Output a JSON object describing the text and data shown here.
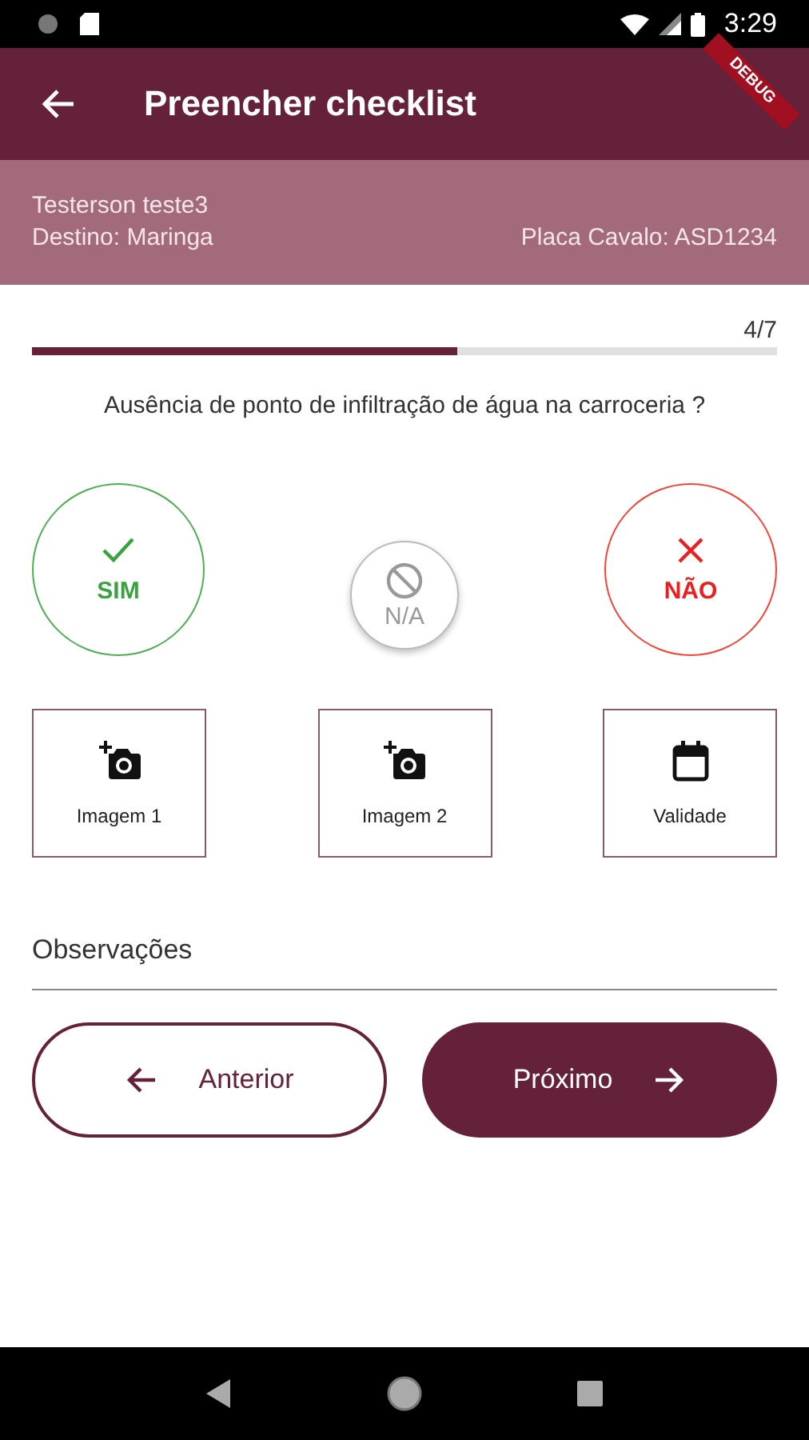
{
  "status_bar": {
    "time": "3:29"
  },
  "debug_banner": "DEBUG",
  "app_bar": {
    "title": "Preencher checklist"
  },
  "info": {
    "name": "Testerson teste3",
    "destination": "Destino: Maringa",
    "plate": "Placa Cavalo: ASD1234"
  },
  "progress": {
    "label": "4/7",
    "level": 0.571
  },
  "question": "Ausência de ponto de infiltração de água na carroceria ?",
  "options": [
    {
      "kind": "yes",
      "label": "SIM",
      "selected": false
    },
    {
      "kind": "na",
      "label": "N/A",
      "selected": false
    },
    {
      "kind": "no",
      "label": "NÃO",
      "selected": false
    }
  ],
  "attachments": [
    {
      "kind": "camera",
      "label": "Imagem 1"
    },
    {
      "kind": "camera",
      "label": "Imagem 2"
    },
    {
      "kind": "calendar",
      "label": "Validade"
    }
  ],
  "observations": {
    "placeholder": "Observações"
  },
  "buttons": [
    {
      "kind": "back",
      "label": "Anterior"
    },
    {
      "kind": "next",
      "label": "Próximo"
    }
  ]
}
